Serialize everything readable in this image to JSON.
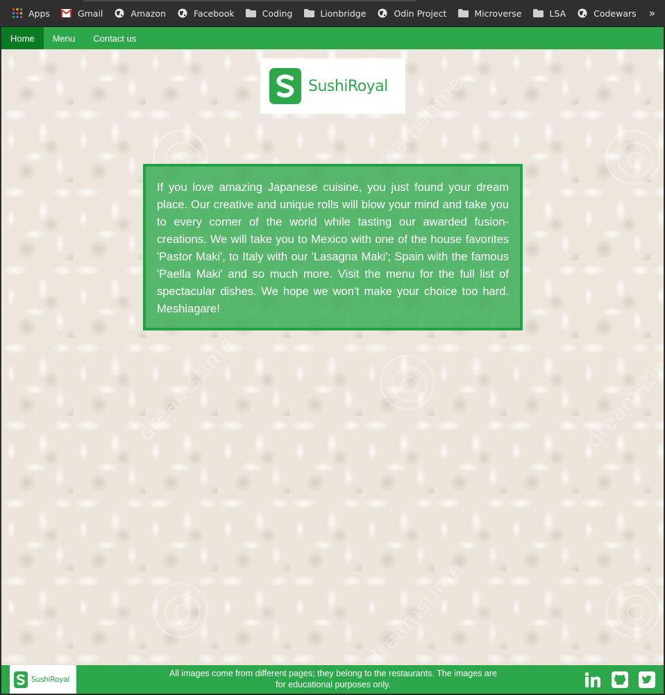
{
  "bookmarks": {
    "items": [
      {
        "label": "Apps",
        "icon": "apps-grid-icon"
      },
      {
        "label": "Gmail",
        "icon": "gmail-icon"
      },
      {
        "label": "Amazon",
        "icon": "globe-icon"
      },
      {
        "label": "Facebook",
        "icon": "globe-icon"
      },
      {
        "label": "Coding",
        "icon": "folder-icon"
      },
      {
        "label": "Lionbridge",
        "icon": "folder-icon"
      },
      {
        "label": "Odin Project",
        "icon": "globe-icon"
      },
      {
        "label": "Microverse",
        "icon": "folder-icon"
      },
      {
        "label": "LSA",
        "icon": "folder-icon"
      },
      {
        "label": "Codewars",
        "icon": "globe-icon"
      }
    ],
    "more": "»"
  },
  "nav": {
    "items": [
      {
        "label": "Home",
        "active": true
      },
      {
        "label": "Menu",
        "active": false
      },
      {
        "label": "Contact us",
        "active": false
      }
    ]
  },
  "logo": {
    "text": "SushiRoyal",
    "mark": "S"
  },
  "intro": {
    "text": "If you love amazing Japanese cuisine, you just found your dream place. Our creative and unique rolls will blow your mind and take you to every corner of the world while tasting our awarded fusion-creations. We will take you to Mexico with one of the house favorites 'Pastor Maki', to Italy with our 'Lasagna Maki'; Spain with the famous 'Paella Maki' and so much more. Visit the menu for the full list of spectacular dishes. We hope we won't make your choice too hard. Meshiagare!"
  },
  "watermark": {
    "text": "dreamstime"
  },
  "footer": {
    "logo_text": "SushiRoyal",
    "logo_mark": "S",
    "note": "All images come from different pages; they belong to the restaurants. The images are for educational purposes only.",
    "socials": [
      "linkedin-icon",
      "github-icon",
      "twitter-icon"
    ]
  },
  "colors": {
    "brand_green": "#2ca84a",
    "active_nav": "#0a7a23",
    "bookmark_bar": "#2f2f2f"
  }
}
